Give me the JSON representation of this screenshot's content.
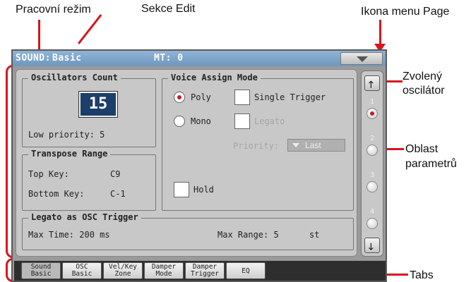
{
  "callouts": {
    "mode": "Pracovní režim",
    "edit_section": "Sekce Edit",
    "page_menu_icon": "Ikona menu Page",
    "selected_osc_1": "Zvolený",
    "selected_osc_2": "oscilátor",
    "param_area_1": "Oblast",
    "param_area_2": "parametrů",
    "tabs": "Tabs"
  },
  "titlebar": {
    "mode": "SOUND:",
    "section": "Basic",
    "mt": "MT: 0"
  },
  "oscillators_count": {
    "title": "Oscillators Count",
    "value": "15",
    "low_priority": "Low priority: 5"
  },
  "transpose_range": {
    "title": "Transpose Range",
    "top_key_label": "Top Key:",
    "top_key_value": "C9",
    "bottom_key_label": "Bottom Key:",
    "bottom_key_value": "C-1"
  },
  "voice_assign": {
    "title": "Voice Assign Mode",
    "poly": "Poly",
    "mono": "Mono",
    "selected": "Poly",
    "single_trigger": "Single Trigger",
    "legato": "Legato",
    "priority_label": "Priority:",
    "priority_value": "Last",
    "hold": "Hold"
  },
  "legato_osc": {
    "title": "Legato as OSC Trigger",
    "max_time": "Max Time: 200  ms",
    "max_range": "Max Range: 5",
    "max_range_unit": "st"
  },
  "oscillator_selector": {
    "numbers": [
      "1",
      "2",
      "3",
      "4"
    ],
    "selected_index": 1
  },
  "tabs": [
    "Sound\nBasic",
    "OSC\nBasic",
    "Vel/Key\nZone",
    "Damper\nMode",
    "Damper\nTrigger",
    "EQ"
  ],
  "active_tab": 0,
  "colors": {
    "callout_red": "#d8151c",
    "title_bar": "#7fa6cb",
    "value_box": "#1c3e6a",
    "radio_dot": "#c0202a"
  },
  "icons": [
    "page-menu-down-arrow-icon",
    "scroll-up-arrow-icon",
    "scroll-down-arrow-icon"
  ]
}
